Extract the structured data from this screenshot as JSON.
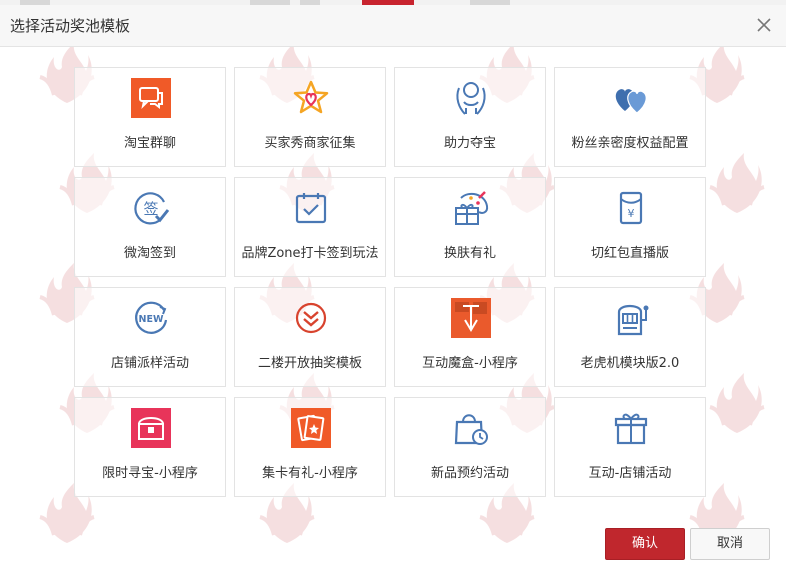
{
  "dialog": {
    "title": "选择活动奖池模板",
    "close_icon": "close-icon"
  },
  "templates": [
    {
      "label": "淘宝群聊",
      "icon": "chat-bubble-icon"
    },
    {
      "label": "买家秀商家征集",
      "icon": "star-heart-icon"
    },
    {
      "label": "助力夺宝",
      "icon": "raised-hands-icon"
    },
    {
      "label": "粉丝亲密度权益配置",
      "icon": "two-hearts-icon"
    },
    {
      "label": "微淘签到",
      "icon": "sign-check-icon"
    },
    {
      "label": "品牌Zone打卡签到玩法",
      "icon": "calendar-check-icon"
    },
    {
      "label": "换肤有礼",
      "icon": "palette-gift-icon"
    },
    {
      "label": "切红包直播版",
      "icon": "red-packet-icon"
    },
    {
      "label": "店铺派样活动",
      "icon": "new-badge-icon"
    },
    {
      "label": "二楼开放抽奖模板",
      "icon": "chevrons-down-icon"
    },
    {
      "label": "互动魔盒-小程序",
      "icon": "magic-box-icon"
    },
    {
      "label": "老虎机模块版2.0",
      "icon": "slot-machine-icon"
    },
    {
      "label": "限时寻宝-小程序",
      "icon": "treasure-chest-icon"
    },
    {
      "label": "集卡有礼-小程序",
      "icon": "collect-card-icon"
    },
    {
      "label": "新品预约活动",
      "icon": "shopping-bag-clock-icon"
    },
    {
      "label": "互动-店铺活动",
      "icon": "gift-box-icon"
    }
  ],
  "footer": {
    "confirm_label": "确认",
    "cancel_label": "取消"
  },
  "colors": {
    "primary_red": "#c0272d",
    "icon_blue": "#4a78b4",
    "icon_orange": "#f05a28"
  }
}
